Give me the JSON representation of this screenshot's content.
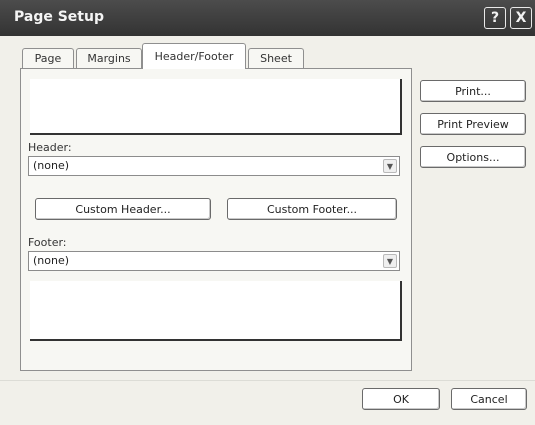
{
  "window": {
    "title": "Page Setup",
    "help_glyph": "?",
    "close_glyph": "X"
  },
  "tabs": [
    {
      "label": "Page"
    },
    {
      "label": "Margins"
    },
    {
      "label": "Header/Footer",
      "active": true
    },
    {
      "label": "Sheet"
    }
  ],
  "header": {
    "label": "Header:",
    "value": "(none)"
  },
  "custom_header_button": "Custom Header...",
  "custom_footer_button": "Custom Footer...",
  "footer": {
    "label": "Footer:",
    "value": "(none)"
  },
  "side_buttons": {
    "print": "Print...",
    "print_preview": "Print Preview",
    "options": "Options..."
  },
  "dialog_buttons": {
    "ok": "OK",
    "cancel": "Cancel"
  },
  "combo_arrow_glyph": "▼",
  "colors": {
    "titlebar": "#3f3f3f",
    "dialog_bg": "#f1f0ea"
  }
}
